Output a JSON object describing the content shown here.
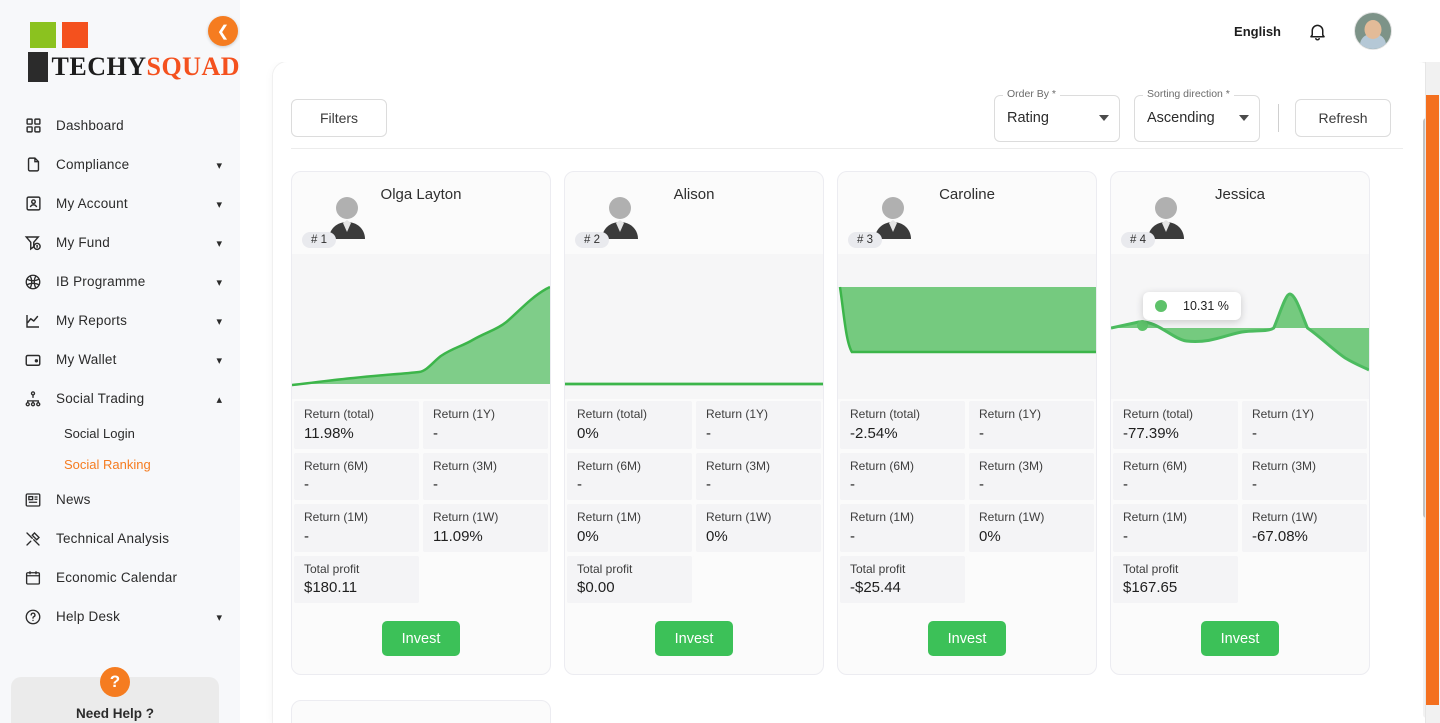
{
  "brand": {
    "name_part1": "TECHY",
    "name_part2": "SQUAD",
    "accent_orange": "#f4511e",
    "accent_green": "#8bc21f"
  },
  "sidebar": {
    "collapse_icon": "chevron-left-icon",
    "items": [
      {
        "label": "Dashboard",
        "icon": "grid-icon",
        "expandable": false
      },
      {
        "label": "Compliance",
        "icon": "document-icon",
        "expandable": true
      },
      {
        "label": "My Account",
        "icon": "user-card-icon",
        "expandable": true
      },
      {
        "label": "My Fund",
        "icon": "funnel-dollar-icon",
        "expandable": true
      },
      {
        "label": "IB Programme",
        "icon": "network-ball-icon",
        "expandable": true
      },
      {
        "label": "My Reports",
        "icon": "line-chart-icon",
        "expandable": true
      },
      {
        "label": "My Wallet",
        "icon": "wallet-icon",
        "expandable": true
      },
      {
        "label": "Social Trading",
        "icon": "sitemap-icon",
        "expandable": true,
        "expanded": true
      }
    ],
    "sub_items": [
      {
        "label": "Social Login",
        "active": false
      },
      {
        "label": "Social Ranking",
        "active": true
      }
    ],
    "items_after": [
      {
        "label": "News",
        "icon": "newspaper-icon",
        "expandable": false
      },
      {
        "label": "Technical Analysis",
        "icon": "tools-icon",
        "expandable": false
      },
      {
        "label": "Economic Calendar",
        "icon": "calendar-icon",
        "expandable": false
      },
      {
        "label": "Help Desk",
        "icon": "help-circle-icon",
        "expandable": true
      }
    ],
    "help": {
      "float_icon": "question-mark-icon",
      "card_label": "Need Help ?"
    }
  },
  "topbar": {
    "language": "English",
    "bell_icon": "bell-icon",
    "avatar": "user-avatar"
  },
  "toolbar": {
    "filters_label": "Filters",
    "order_by": {
      "label": "Order By *",
      "value": "Rating"
    },
    "sorting_direction": {
      "label": "Sorting direction *",
      "value": "Ascending"
    },
    "refresh_label": "Refresh"
  },
  "stat_labels": {
    "total": "Return (total)",
    "y1": "Return (1Y)",
    "m6": "Return (6M)",
    "m3": "Return (3M)",
    "m1": "Return (1M)",
    "w1": "Return (1W)",
    "profit": "Total profit"
  },
  "invest_label": "Invest",
  "cards": [
    {
      "name": "Olga Layton",
      "rank": "# 1",
      "return_total": "11.98%",
      "return_1y": "-",
      "return_6m": "-",
      "return_3m": "-",
      "return_1m": "-",
      "return_1w": "11.09%",
      "total_profit": "$180.11",
      "tooltip": null
    },
    {
      "name": "Alison",
      "rank": "# 2",
      "return_total": "0%",
      "return_1y": "-",
      "return_6m": "-",
      "return_3m": "-",
      "return_1m": "0%",
      "return_1w": "0%",
      "total_profit": "$0.00",
      "tooltip": null
    },
    {
      "name": "Caroline",
      "rank": "# 3",
      "return_total": "-2.54%",
      "return_1y": "-",
      "return_6m": "-",
      "return_3m": "-",
      "return_1m": "-",
      "return_1w": "0%",
      "total_profit": "-$25.44",
      "tooltip": null
    },
    {
      "name": "Jessica",
      "rank": "# 4",
      "return_total": "-77.39%",
      "return_1y": "-",
      "return_6m": "-",
      "return_3m": "-",
      "return_1m": "-",
      "return_1w": "-67.08%",
      "total_profit": "$167.65",
      "tooltip": "10.31 %"
    }
  ],
  "colors": {
    "chart_green": "#5ec26a",
    "invest_green": "#3cc158",
    "orange": "#f57c20",
    "chart_bg": "#f6f6f7"
  }
}
